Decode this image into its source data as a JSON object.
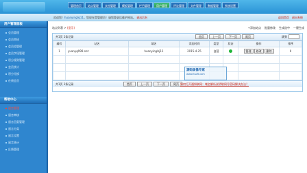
{
  "nav": {
    "items": [
      "管理首页",
      "站点管理",
      "文档管理",
      "模板管理",
      "栏目管理",
      "用户管理",
      "评论管理",
      "文件管理",
      "数据管理",
      "系统设置"
    ],
    "active_index": 5
  },
  "welcome": {
    "prefix": "欢迎您！",
    "user": "huanyinglsj11",
    "mid": "，您现在是管理员！请您登录后维护网站。",
    "link": "退出后台"
  },
  "toplinks": {
    "home": "返回首页",
    "logout": "退出系统"
  },
  "sidebar": {
    "section1_title": "用户管理面板",
    "section1_items": [
      "会员管理",
      "会员审核",
      "会员组管理",
      "会员字段管理",
      "积分规则管理",
      "会员统计",
      "积分兑换",
      "在线会员"
    ],
    "section2_title": "帮助中心",
    "section2_items": [
      "留言管理",
      "留言审核",
      "留言回复管理",
      "留言分类",
      "留言设置",
      "留言统计",
      "反馈管理"
    ],
    "selected_item": "留言管理"
  },
  "breadcrumb": {
    "prefix": "站点列表 >",
    "current": "(显示)"
  },
  "actions": [
    "+添加站点",
    "批量修改",
    "生成选中",
    "一键生成"
  ],
  "pager": {
    "info": "共1页 1条记录",
    "buttons": [
      "首页",
      "上一页",
      "下一页",
      "尾页"
    ],
    "page_label": "跳到"
  },
  "table": {
    "columns": [
      "编号",
      "站名",
      "域名",
      "添加时间",
      "类型",
      "状态",
      "操作",
      "排序"
    ],
    "rows": [
      {
        "id": "1",
        "name": "yuanyq999.net",
        "domain": "huanyinglsj11",
        "date": "2015-4-25",
        "type": "自营",
        "status": "active",
        "ops": [
          "管理",
          "修改",
          "删除"
        ],
        "sort": "0"
      }
    ]
  },
  "footer": {
    "info": "共1页 1条记录",
    "notice": "如何打开通知联网：域名解析说明联网号密码解决办法？"
  },
  "watermark": {
    "title": "源码录像专家",
    "url": "www.itsoft.com"
  }
}
